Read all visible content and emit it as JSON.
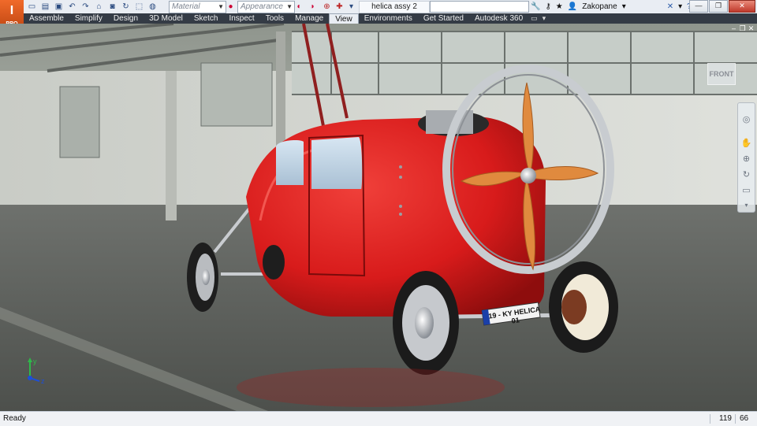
{
  "app": {
    "logo_letter": "I",
    "logo_sub": "PRO",
    "document_title": "helica assy 2",
    "material_placeholder": "Material",
    "appearance_placeholder": "Appearance",
    "user_name": "Zakopane"
  },
  "ribbon": {
    "tabs": [
      "Assemble",
      "Simplify",
      "Design",
      "3D Model",
      "Sketch",
      "Inspect",
      "Tools",
      "Manage",
      "View",
      "Environments",
      "Get Started",
      "Autodesk 360"
    ],
    "active_tab": "View"
  },
  "viewport": {
    "viewcube_label": "FRONT",
    "license_plate": "19 - KY HELICA 01",
    "triad_y": "y",
    "triad_z": "z",
    "body_color": "#d81b1b",
    "propeller_color": "#e08a3e"
  },
  "status": {
    "text": "Ready",
    "value1": "119",
    "value2": "66"
  }
}
